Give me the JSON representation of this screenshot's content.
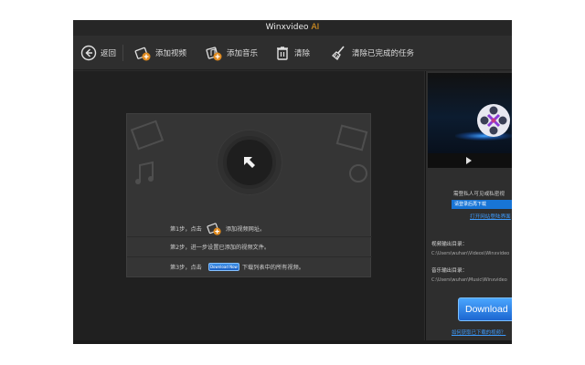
{
  "window": {
    "title": "Winxvideo",
    "title_suffix": "AI"
  },
  "toolbar": {
    "back_label": "返回",
    "add_video_label": "添加视频",
    "add_music_label": "添加音乐",
    "clear_label": "清除",
    "clear_done_label": "清除已完成的任务"
  },
  "steps": {
    "step1_prefix": "第1步，点击",
    "step1_suffix": "添加视频网址。",
    "step2": "第2步，进一步设置已添加的视频文件。",
    "step3_prefix": "第3步，点击",
    "step3_button": "Download Now",
    "step3_suffix": "下载列表中的所有视频。"
  },
  "right_panel": {
    "notice": "需登私人可见或私密视",
    "login_bar": "请登录后再下载",
    "open_link": "打开网站登陆界面",
    "video_output_label": "视频输出目录：",
    "video_output_path": "C:\\Users\\wuhan\\Videos\\Winxvideo",
    "music_output_label": "音乐输出目录：",
    "music_output_path": "C:\\Users\\wuhan\\Music\\Winxvideo",
    "download_label": "Download",
    "bottom_link": "如何获取已下载的视频？"
  },
  "colors": {
    "accent_blue": "#1c66d0",
    "link_blue": "#3d9cff",
    "ai_orange": "#f0a020",
    "window_bg": "#2b2b2b"
  },
  "icons": {
    "back": "back-circle-arrow-icon",
    "add_video": "add-video-icon",
    "add_music": "add-music-icon",
    "clear": "trash-icon",
    "clear_done": "broom-icon",
    "center": "arrow-up-left-icon",
    "reel": "film-reel-icon",
    "play": "play-icon"
  }
}
